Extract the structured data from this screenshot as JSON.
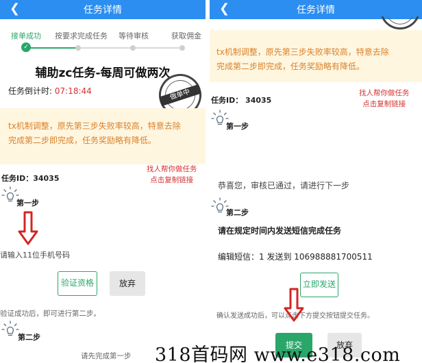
{
  "left": {
    "header": {
      "title": "任务详情"
    },
    "steps": [
      "接单成功",
      "按要求完成任务",
      "等待审核",
      "获取佣金"
    ],
    "task_title": "辅助zc任务-每周可做两次",
    "countdown": {
      "label": "任务倒计时:",
      "time": "07:18:44"
    },
    "stamp_text": "做单中",
    "notice": [
      "tx机制调整，原先第三步失败率较高，特意去除",
      "完成第二步即完成，任务奖励略有降低。"
    ],
    "task_id": "任务ID：34035",
    "helper": [
      "找人帮你做任务",
      "点击复制链接"
    ],
    "step1_label": "第一步",
    "phone_placeholder": "请输入11位手机号码",
    "verify_button": "验证资格",
    "abandon_button": "放弃",
    "after_verify": "验证成功后，即可进行第二步。",
    "step2_label": "第二步",
    "complete_first": "请先完成第一步"
  },
  "right": {
    "header": {
      "title": "任务详情"
    },
    "notice": [
      "tx机制调整，原先第三步失败率较高，特意去除",
      "完成第二步即完成，任务奖励略有降低。"
    ],
    "task_id": "任务ID：  34035",
    "helper": [
      "找人帮你做任务",
      "点击复制链接"
    ],
    "step1_label": "第一步",
    "passed_text": "恭喜您，审核已通过，请进行下一步",
    "step2_label": "第二步",
    "sms_heading": "请在规定时间内发送短信完成任务",
    "sms_text": "编辑短信：1 发送到 106988881700511",
    "send_button": "立即发送",
    "confirm_text": "确认发送成功后，可以点击下方提交按钮提交任务。",
    "submit_button": "提交",
    "abandon_button": "放弃"
  },
  "watermark": "318首码网 www.e318.com"
}
